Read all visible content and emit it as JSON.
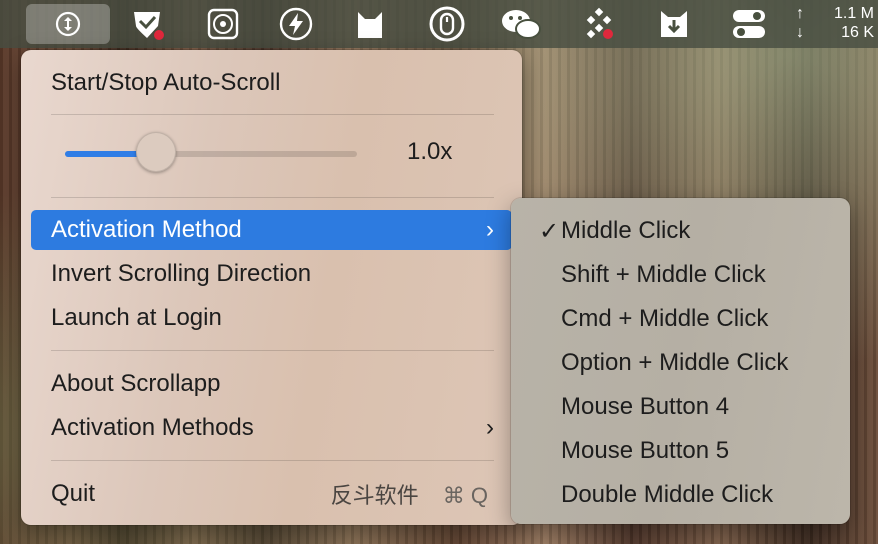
{
  "menubar": {
    "items": [
      {
        "name": "scrollapp-icon"
      },
      {
        "name": "shield-check-icon"
      },
      {
        "name": "chip-icon"
      },
      {
        "name": "lightning-icon"
      },
      {
        "name": "cat-icon"
      },
      {
        "name": "mouse-icon"
      },
      {
        "name": "wechat-icon"
      },
      {
        "name": "dots-grid-icon"
      },
      {
        "name": "download-cat-icon"
      },
      {
        "name": "toggles-icon"
      }
    ],
    "net_up": "1.1 M",
    "net_down": "16 K",
    "net_up_arrow": "↑",
    "net_down_arrow": "↓"
  },
  "main_menu": {
    "start_stop": "Start/Stop Auto-Scroll",
    "slider": {
      "value_label": "1.0x",
      "fraction": 0.31
    },
    "activation_method": "Activation Method",
    "invert": "Invert Scrolling Direction",
    "launch_at_login": "Launch at Login",
    "about": "About Scrollapp",
    "activation_methods": "Activation Methods",
    "quit": "Quit",
    "quit_extra": "反斗软件",
    "quit_shortcut": "⌘ Q",
    "chevron": "›"
  },
  "sub_menu": {
    "check_mark": "✓",
    "items": [
      {
        "label": "Middle Click",
        "checked": true
      },
      {
        "label": "Shift + Middle Click",
        "checked": false
      },
      {
        "label": "Cmd + Middle Click",
        "checked": false
      },
      {
        "label": "Option + Middle Click",
        "checked": false
      },
      {
        "label": "Mouse Button 4",
        "checked": false
      },
      {
        "label": "Mouse Button 5",
        "checked": false
      },
      {
        "label": "Double Middle Click",
        "checked": false
      }
    ]
  },
  "colors": {
    "accent": "#2d7be0"
  }
}
